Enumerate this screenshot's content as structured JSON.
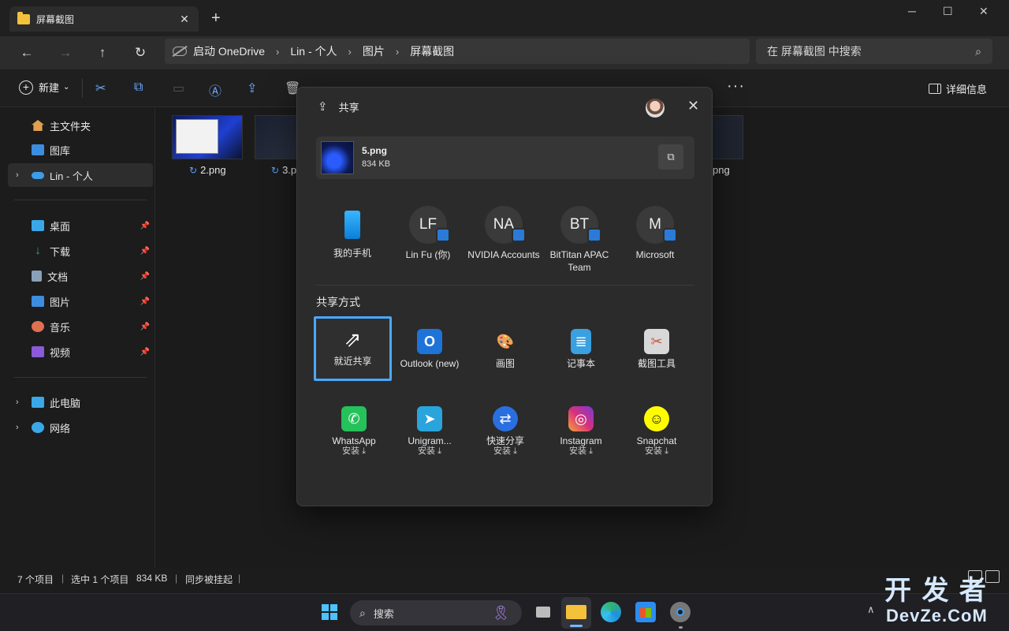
{
  "window": {
    "tab_title": "屏幕截图",
    "tab_close": "✕",
    "new_tab": "+",
    "minimize": "─",
    "maximize": "☐",
    "close": "✕"
  },
  "nav": {
    "back": "←",
    "forward": "→",
    "up": "↑",
    "refresh": "↻"
  },
  "address": {
    "crumbs": [
      "启动 OneDrive",
      "Lin - 个人",
      "图片",
      "屏幕截图"
    ],
    "sep": "›"
  },
  "search": {
    "placeholder": "在 屏幕截图 中搜索",
    "icon": "⌕"
  },
  "toolbar": {
    "new_label": "新建",
    "new_chevron": "⌄",
    "more": "···",
    "details_label": "详细信息",
    "icons": [
      "cut-icon",
      "copy-icon",
      "paste-icon",
      "rename-icon",
      "share-icon",
      "delete-icon"
    ]
  },
  "sidebar": {
    "items": [
      {
        "label": "主文件夹",
        "icon": "home-icon",
        "color": "#e0a050"
      },
      {
        "label": "图库",
        "icon": "gallery-icon",
        "color": "#3c8de0"
      },
      {
        "label": "Lin - 个人",
        "icon": "onedrive-icon",
        "color": "#3c9de8"
      },
      {
        "label": "桌面",
        "icon": "desktop-icon",
        "color": "#3aa8e8"
      },
      {
        "label": "下载",
        "icon": "download-icon",
        "color": "#2fb36b"
      },
      {
        "label": "文档",
        "icon": "documents-icon",
        "color": "#8aa0b8"
      },
      {
        "label": "图片",
        "icon": "pictures-icon",
        "color": "#3c8de0"
      },
      {
        "label": "音乐",
        "icon": "music-icon",
        "color": "#e07050"
      },
      {
        "label": "视频",
        "icon": "videos-icon",
        "color": "#8a5ad8"
      },
      {
        "label": "此电脑",
        "icon": "pc-icon",
        "color": "#3aa8e8"
      },
      {
        "label": "网络",
        "icon": "network-icon",
        "color": "#3aa8e8"
      }
    ],
    "chevron": "›",
    "pin": "📌"
  },
  "files": [
    {
      "name": "2.png"
    },
    {
      "name": "3.p"
    },
    {
      "name": "png"
    }
  ],
  "sync_glyph": "↻",
  "status": {
    "count": "7 个项目",
    "selected": "选中 1 个项目",
    "size": "834 KB",
    "sync": "同步被挂起",
    "bar": "|"
  },
  "share": {
    "title": "共享",
    "close": "✕",
    "file": {
      "name": "5.png",
      "size": "834 KB"
    },
    "copy_glyph": "⧉",
    "contacts": [
      {
        "initials": "",
        "label": "我的手机",
        "type": "phone"
      },
      {
        "initials": "LF",
        "label": "Lin Fu (你)"
      },
      {
        "initials": "NA",
        "label": "NVIDIA Accounts"
      },
      {
        "initials": "BT",
        "label": "BitTitan APAC Team"
      },
      {
        "initials": "M",
        "label": "Microsoft"
      }
    ],
    "section_title": "共享方式",
    "apps": [
      {
        "label": "就近共享",
        "sub": "",
        "color": "transparent",
        "glyph": "⇗"
      },
      {
        "label": "Outlook (new)",
        "sub": "",
        "color": "#1e73d8",
        "glyph": "O"
      },
      {
        "label": "画图",
        "sub": "",
        "color": "#3b6fb0",
        "glyph": "🎨"
      },
      {
        "label": "记事本",
        "sub": "",
        "color": "#3aa0e0",
        "glyph": "≣"
      },
      {
        "label": "截图工具",
        "sub": "",
        "color": "#d8d8d8",
        "glyph": "✂"
      },
      {
        "label": "WhatsApp",
        "sub": "安装 ⤓",
        "color": "#25c15a",
        "glyph": "✆"
      },
      {
        "label": "Unigram...",
        "sub": "安装 ⤓",
        "color": "#2aa4dc",
        "glyph": "➤"
      },
      {
        "label": "快速分享",
        "sub": "安装 ⤓",
        "color": "#2a6fe0",
        "glyph": "⇄"
      },
      {
        "label": "Instagram",
        "sub": "安装 ⤓",
        "color": "#d6307c",
        "glyph": "◎"
      },
      {
        "label": "Snapchat",
        "sub": "安装 ⤓",
        "color": "#fffc00",
        "glyph": "☺"
      }
    ]
  },
  "taskbar": {
    "search_label": "搜索",
    "search_icon": "⌕",
    "ribbon": "🎗",
    "chevron": "∧"
  },
  "watermark": {
    "line1": "开 发 者",
    "line2": "DevZe.CoM"
  },
  "colors": {
    "accent": "#4aa8ff",
    "background": "#1b1b1b",
    "dialog": "#2b2b2b"
  }
}
